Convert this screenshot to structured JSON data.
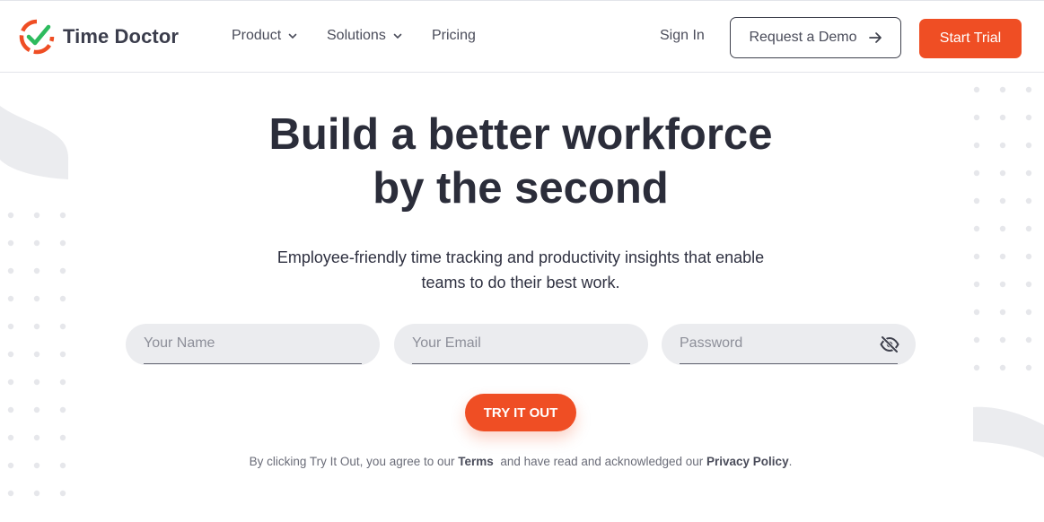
{
  "brand": {
    "name": "Time Doctor",
    "accent": "#ef4e24",
    "check_color": "#2dbb5e"
  },
  "nav": {
    "product": "Product",
    "solutions": "Solutions",
    "pricing": "Pricing",
    "sign_in": "Sign In",
    "request_demo": "Request a Demo",
    "start_trial": "Start Trial"
  },
  "hero": {
    "title_line1": "Build a better workforce",
    "title_line2": "by the second",
    "subtitle_line1": "Employee-friendly time tracking and productivity insights that enable",
    "subtitle_line2": "teams to do their best work."
  },
  "form": {
    "name_placeholder": "Your Name",
    "email_placeholder": "Your Email",
    "password_placeholder": "Password",
    "submit": "TRY IT OUT"
  },
  "legal": {
    "prefix": "By clicking Try It Out, you agree to our",
    "terms": "Terms",
    "middle": "and have read and acknowledged our",
    "privacy": "Privacy Policy",
    "suffix": "."
  },
  "icons": {
    "logo": "clock-check-icon",
    "chevron": "chevron-down-icon",
    "arrow": "arrow-right-icon",
    "eye": "eye-slash-icon"
  }
}
